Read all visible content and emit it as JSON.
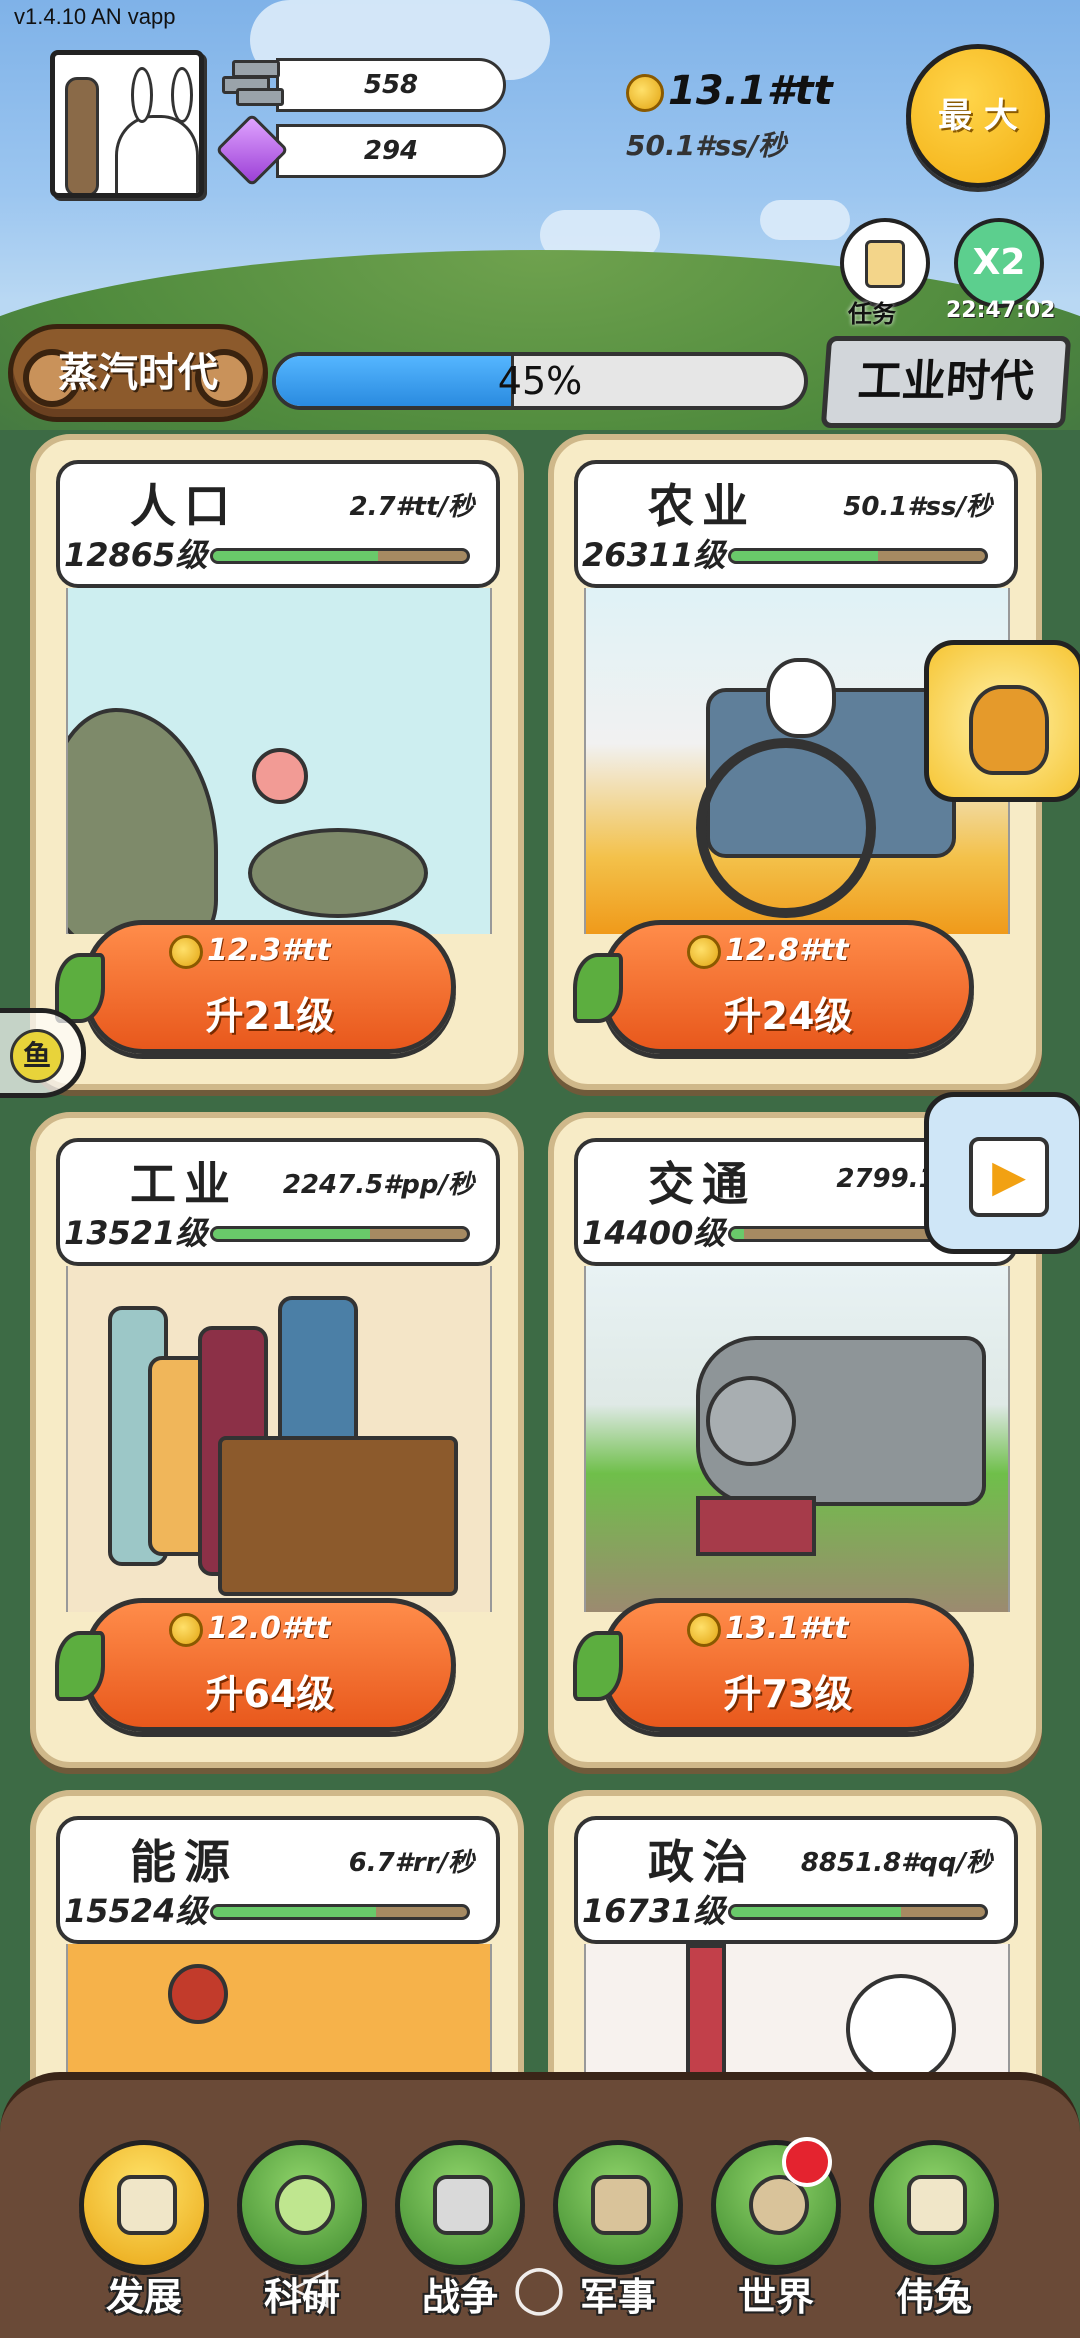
{
  "status": {
    "version": "v1.4.10 AN vapp"
  },
  "header": {
    "iron_amount": "558",
    "gem_amount": "294",
    "coin_total": "13.1#tt",
    "coin_rate": "50.1#ss/秒",
    "max_button": "最 大",
    "task_label": "任务",
    "boost_label": "X2",
    "boost_timer": "22:47:02"
  },
  "era": {
    "current": "蒸汽时代",
    "next": "工业时代",
    "progress_text": "45%",
    "progress": 0.45
  },
  "cards": [
    {
      "title": "人口",
      "rate": "2.7#tt/秒",
      "level": "12865级",
      "bar": 0.65,
      "cost": "12.3#tt",
      "upgrade": "升21级"
    },
    {
      "title": "农业",
      "rate": "50.1#ss/秒",
      "level": "26311级",
      "bar": 0.58,
      "cost": "12.8#tt",
      "upgrade": "升24级"
    },
    {
      "title": "工业",
      "rate": "2247.5#pp/秒",
      "level": "13521级",
      "bar": 0.62,
      "cost": "12.0#tt",
      "upgrade": "升64级"
    },
    {
      "title": "交通",
      "rate": "2799.1#qq",
      "level": "14400级",
      "bar": 0.05,
      "cost": "13.1#tt",
      "upgrade": "升73级"
    },
    {
      "title": "能源",
      "rate": "6.7#rr/秒",
      "level": "15524级",
      "bar": 0.64,
      "cost": "",
      "upgrade": ""
    },
    {
      "title": "政治",
      "rate": "8851.8#qq/秒",
      "level": "16731级",
      "bar": 0.67,
      "cost": "",
      "upgrade": ""
    }
  ],
  "nav": [
    {
      "label": "发展"
    },
    {
      "label": "科研"
    },
    {
      "label": "战争"
    },
    {
      "label": "军事"
    },
    {
      "label": "世界"
    },
    {
      "label": "伟兔"
    }
  ],
  "icons": {
    "fish": "鱼",
    "play": "▶",
    "system_back": "◁",
    "system_home": "○"
  },
  "colors": {
    "accent": "#f2ad10",
    "progress": "#2a8be0",
    "level_bar": "#69c96a"
  }
}
